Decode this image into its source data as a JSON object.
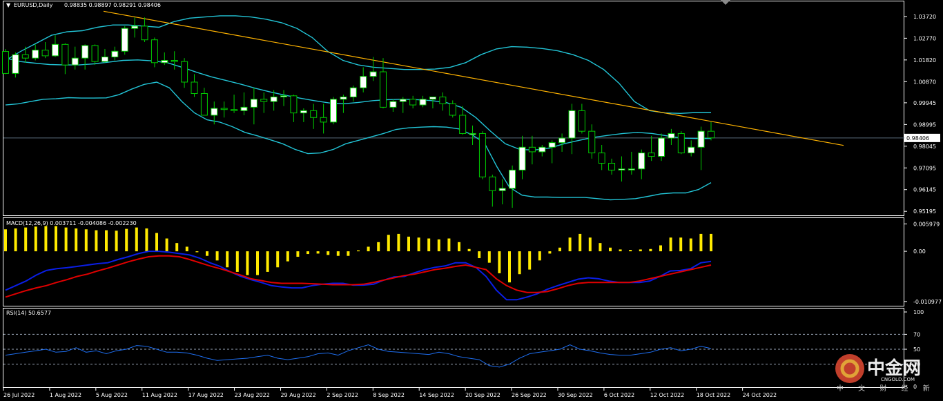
{
  "header": {
    "arrow": "▼",
    "symbol": "EURUSD,Daily",
    "ohlc": "0.98835 0.98897 0.98291 0.98406"
  },
  "colors": {
    "background": "#000000",
    "grid_frame": "#ffffff",
    "bull_candle": "#ffffff",
    "bear_candle": "#000000",
    "wick": "#00cc00",
    "bollinger": "#22c4d6",
    "trendline": "#ffb300",
    "macd_hist": "#ffea00",
    "macd_line": "#0a1ee6",
    "signal_line": "#e00000",
    "rsi_line": "#1e6ef0",
    "level_line": "#9aa6b8"
  },
  "chart_data": [
    {
      "type": "candlestick",
      "title": "EURUSD,Daily",
      "ohlc_label": "0.98835 0.98897 0.98291 0.98406",
      "current_price_label": "0.98406",
      "ylim": [
        0.9514,
        1.0402
      ],
      "y_ticks": [
        "1.03720",
        "1.02770",
        "1.01820",
        "1.00870",
        "0.99945",
        "0.98995",
        "0.98045",
        "0.97095",
        "0.96145",
        "0.95195"
      ],
      "x_tick_labels": [
        "26 Jul 2022",
        "1 Aug 2022",
        "5 Aug 2022",
        "11 Aug 2022",
        "17 Aug 2022",
        "23 Aug 2022",
        "29 Aug 2022",
        "2 Sep 2022",
        "8 Sep 2022",
        "14 Sep 2022",
        "20 Sep 2022",
        "26 Sep 2022",
        "30 Sep 2022",
        "6 Oct 2022",
        "12 Oct 2022",
        "18 Oct 2022",
        "24 Oct 2022"
      ],
      "trendline": {
        "start_value": 1.0395,
        "end_value": 0.9808
      },
      "bollinger": {
        "upper": [
          1.018,
          1.022,
          1.0255,
          1.029,
          1.0305,
          1.031,
          1.0325,
          1.0335,
          1.0335,
          1.033,
          1.0325,
          1.035,
          1.0365,
          1.037,
          1.0375,
          1.0375,
          1.037,
          1.036,
          1.0345,
          1.032,
          1.028,
          1.022,
          1.018,
          1.016,
          1.015,
          1.0145,
          1.014,
          1.014,
          1.0142,
          1.015,
          1.017,
          1.0205,
          1.023,
          1.024,
          1.0238,
          1.0232,
          1.0222,
          1.0205,
          1.018,
          1.014,
          1.008,
          1.0,
          0.996,
          0.995,
          0.9948,
          0.9952,
          0.9952
        ],
        "middle": [
          1.019,
          1.0175,
          1.0168,
          1.0162,
          1.016,
          1.016,
          1.0165,
          1.0172,
          1.018,
          1.0182,
          1.0178,
          1.017,
          1.015,
          1.0128,
          1.0108,
          1.0092,
          1.0076,
          1.0058,
          1.0042,
          1.0028,
          1.0015,
          1.0004,
          0.9994,
          0.999,
          0.9996,
          1.0004,
          1.0008,
          1.001,
          1.0008,
          1.0004,
          0.9995,
          0.9975,
          0.993,
          0.987,
          0.9815,
          0.979,
          0.9788,
          0.9796,
          0.9815,
          0.983,
          0.9843,
          0.9852,
          0.986,
          0.9865,
          0.986,
          0.985,
          0.984,
          0.9838,
          0.9838
        ],
        "lower": [
          0.9985,
          0.999,
          1.0,
          1.001,
          1.0012,
          1.0017,
          1.0015,
          1.0015,
          1.0016,
          1.003,
          1.0054,
          1.0075,
          1.0085,
          1.006,
          1.0,
          0.995,
          0.992,
          0.991,
          0.989,
          0.9865,
          0.985,
          0.9833,
          0.9815,
          0.979,
          0.9772,
          0.9775,
          0.979,
          0.9815,
          0.983,
          0.9845,
          0.986,
          0.9878,
          0.9885,
          0.9888,
          0.989,
          0.9888,
          0.988,
          0.9855,
          0.982,
          0.9715,
          0.9625,
          0.959,
          0.9582,
          0.9582,
          0.958,
          0.958,
          0.958,
          0.9575,
          0.957,
          0.9572,
          0.9575,
          0.9585,
          0.9596,
          0.96,
          0.96,
          0.9615,
          0.9645
        ]
      },
      "candles": [
        [
          1.0219,
          1.023,
          1.012,
          1.0123
        ],
        [
          1.0123,
          1.0215,
          1.0105,
          1.0205
        ],
        [
          1.0205,
          1.024,
          1.017,
          1.019
        ],
        [
          1.019,
          1.025,
          1.018,
          1.0225
        ],
        [
          1.0225,
          1.026,
          1.019,
          1.02
        ],
        [
          1.02,
          1.029,
          1.0195,
          1.025
        ],
        [
          1.025,
          1.0255,
          1.012,
          1.016
        ],
        [
          1.016,
          1.024,
          1.014,
          1.019
        ],
        [
          1.019,
          1.025,
          1.014,
          1.0245
        ],
        [
          1.0245,
          1.025,
          1.016,
          1.0175
        ],
        [
          1.0175,
          1.023,
          1.017,
          1.0195
        ],
        [
          1.0195,
          1.024,
          1.018,
          1.022
        ],
        [
          1.022,
          1.033,
          1.0205,
          1.032
        ],
        [
          1.032,
          1.0368,
          1.028,
          1.033
        ],
        [
          1.033,
          1.0368,
          1.026,
          1.027
        ],
        [
          1.027,
          1.028,
          1.015,
          1.017
        ],
        [
          1.017,
          1.0215,
          1.016,
          1.018
        ],
        [
          1.018,
          1.022,
          1.014,
          1.0175
        ],
        [
          1.0175,
          1.019,
          1.006,
          1.0085
        ],
        [
          1.0085,
          1.012,
          1.002,
          1.0035
        ],
        [
          1.0035,
          1.006,
          0.994,
          0.994
        ],
        [
          0.994,
          1.0,
          0.99,
          0.997
        ],
        [
          0.997,
          1.0,
          0.993,
          0.9965
        ],
        [
          0.9965,
          1.003,
          0.995,
          0.996
        ],
        [
          0.996,
          1.004,
          0.994,
          0.9975
        ],
        [
          0.9975,
          1.006,
          0.99,
          1.001
        ],
        [
          1.001,
          1.004,
          0.995,
          1.0
        ],
        [
          1.0,
          1.005,
          0.996,
          1.002
        ],
        [
          1.002,
          1.005,
          0.998,
          1.0025
        ],
        [
          1.0025,
          1.003,
          0.991,
          0.995
        ],
        [
          0.995,
          0.997,
          0.991,
          0.996
        ],
        [
          0.996,
          0.999,
          0.988,
          0.993
        ],
        [
          0.993,
          0.999,
          0.986,
          0.991
        ],
        [
          0.991,
          1.002,
          0.99,
          1.001
        ],
        [
          1.001,
          1.003,
          0.995,
          1.002
        ],
        [
          1.002,
          1.007,
          1.0,
          1.006
        ],
        [
          1.006,
          1.015,
          1.004,
          1.011
        ],
        [
          1.011,
          1.0195,
          1.009,
          1.013
        ],
        [
          1.013,
          1.019,
          0.997,
          0.9975
        ],
        [
          0.9975,
          1.001,
          0.9955,
          1.0
        ],
        [
          1.0,
          1.002,
          0.995,
          1.001
        ],
        [
          1.001,
          1.0025,
          0.997,
          0.9985
        ],
        [
          0.9985,
          1.0025,
          0.9975,
          1.001
        ],
        [
          1.001,
          1.002,
          0.997,
          1.002
        ],
        [
          1.002,
          1.004,
          0.996,
          0.999
        ],
        [
          0.999,
          1.0005,
          0.993,
          0.994
        ],
        [
          0.994,
          0.998,
          0.9855,
          0.986
        ],
        [
          0.986,
          0.9895,
          0.981,
          0.986
        ],
        [
          0.986,
          0.987,
          0.966,
          0.967
        ],
        [
          0.967,
          0.968,
          0.954,
          0.961
        ],
        [
          0.961,
          0.966,
          0.955,
          0.962
        ],
        [
          0.962,
          0.972,
          0.9535,
          0.97
        ],
        [
          0.97,
          0.985,
          0.966,
          0.98
        ],
        [
          0.98,
          0.985,
          0.9725,
          0.978
        ],
        [
          0.978,
          0.981,
          0.976,
          0.98
        ],
        [
          0.98,
          0.983,
          0.973,
          0.982
        ],
        [
          0.982,
          0.986,
          0.978,
          0.984
        ],
        [
          0.984,
          0.999,
          0.977,
          0.996
        ],
        [
          0.996,
          0.999,
          0.986,
          0.987
        ],
        [
          0.987,
          0.99,
          0.975,
          0.9775
        ],
        [
          0.9775,
          0.981,
          0.97,
          0.973
        ],
        [
          0.973,
          0.975,
          0.968,
          0.97
        ],
        [
          0.97,
          0.976,
          0.965,
          0.9705
        ],
        [
          0.9705,
          0.978,
          0.968,
          0.9705
        ],
        [
          0.9705,
          0.979,
          0.966,
          0.9775
        ],
        [
          0.9775,
          0.985,
          0.974,
          0.976
        ],
        [
          0.976,
          0.986,
          0.974,
          0.984
        ],
        [
          0.984,
          0.988,
          0.981,
          0.986
        ],
        [
          0.986,
          0.987,
          0.977,
          0.9775
        ],
        [
          0.9775,
          0.983,
          0.976,
          0.98
        ],
        [
          0.98,
          0.989,
          0.97,
          0.987
        ],
        [
          0.987,
          0.991,
          0.983,
          0.9841
        ]
      ]
    },
    {
      "type": "bar+line",
      "title": "MACD(12,26,9) 0.003711 -0.004086 -0.002230",
      "ylim": [
        -0.011,
        0.0065
      ],
      "y_ticks": [
        "0.005979",
        "0.00",
        "-0.010977"
      ],
      "histogram": [
        0.0048,
        0.005,
        0.0052,
        0.0054,
        0.0055,
        0.0055,
        0.0052,
        0.005,
        0.0048,
        0.0046,
        0.0046,
        0.0045,
        0.0049,
        0.0052,
        0.005,
        0.004,
        0.0028,
        0.0018,
        0.001,
        -0.0002,
        -0.001,
        -0.002,
        -0.0035,
        -0.0045,
        -0.0052,
        -0.0052,
        -0.0045,
        -0.0035,
        -0.0022,
        -0.0012,
        -0.0006,
        -0.0005,
        -0.0008,
        -0.001,
        -0.001,
        0.0002,
        0.001,
        0.002,
        0.0036,
        0.0038,
        0.0032,
        0.003,
        0.0028,
        0.0026,
        0.0028,
        0.002,
        0.0005,
        -0.0015,
        -0.0025,
        -0.0048,
        -0.0068,
        -0.005,
        -0.004,
        -0.002,
        -0.0005,
        0.0008,
        0.003,
        0.0038,
        0.003,
        0.0018,
        0.0008,
        0.0004,
        0.0003,
        0.0004,
        0.0005,
        0.0013,
        0.003,
        0.003,
        0.0028,
        0.0038,
        0.0038
      ],
      "macd_line": [
        -0.0085,
        -0.0075,
        -0.0065,
        -0.0052,
        -0.0042,
        -0.0038,
        -0.0036,
        -0.0033,
        -0.003,
        -0.0027,
        -0.0025,
        -0.0018,
        -0.0012,
        -0.0005,
        0.0,
        0.0,
        -0.0002,
        -0.0005,
        -0.0008,
        -0.0015,
        -0.0025,
        -0.0033,
        -0.0045,
        -0.0055,
        -0.0062,
        -0.0068,
        -0.0075,
        -0.0078,
        -0.008,
        -0.008,
        -0.0075,
        -0.0072,
        -0.007,
        -0.007,
        -0.0074,
        -0.0074,
        -0.0072,
        -0.0063,
        -0.0056,
        -0.0055,
        -0.0047,
        -0.004,
        -0.0035,
        -0.0032,
        -0.0025,
        -0.0025,
        -0.0035,
        -0.0055,
        -0.0085,
        -0.0106,
        -0.0106,
        -0.01,
        -0.0093,
        -0.0083,
        -0.0075,
        -0.0068,
        -0.0061,
        -0.0058,
        -0.006,
        -0.0065,
        -0.0068,
        -0.0068,
        -0.0068,
        -0.0065,
        -0.0055,
        -0.0043,
        -0.0042,
        -0.0038,
        -0.0025,
        -0.0022
      ],
      "signal_line": [
        -0.01,
        -0.0093,
        -0.0086,
        -0.008,
        -0.0075,
        -0.0068,
        -0.0062,
        -0.0055,
        -0.005,
        -0.0043,
        -0.0037,
        -0.003,
        -0.0023,
        -0.0017,
        -0.0012,
        -0.001,
        -0.001,
        -0.0012,
        -0.0018,
        -0.0025,
        -0.0032,
        -0.0038,
        -0.0045,
        -0.0052,
        -0.006,
        -0.0064,
        -0.0068,
        -0.007,
        -0.007,
        -0.007,
        -0.0071,
        -0.0072,
        -0.0073,
        -0.0073,
        -0.0073,
        -0.0072,
        -0.0068,
        -0.0063,
        -0.0058,
        -0.0053,
        -0.005,
        -0.0045,
        -0.004,
        -0.0037,
        -0.0033,
        -0.003,
        -0.0035,
        -0.004,
        -0.006,
        -0.0075,
        -0.0085,
        -0.009,
        -0.009,
        -0.0088,
        -0.0082,
        -0.0075,
        -0.007,
        -0.0068,
        -0.0068,
        -0.0068,
        -0.0068,
        -0.0068,
        -0.0065,
        -0.006,
        -0.0055,
        -0.005,
        -0.0045,
        -0.004,
        -0.0035,
        -0.003
      ]
    },
    {
      "type": "line",
      "title": "RSI(14) 50.6577",
      "ylim": [
        0,
        100
      ],
      "y_ticks": [
        "100",
        "70",
        "50",
        "30",
        "0"
      ],
      "levels": [
        70,
        50,
        30
      ],
      "values": [
        42,
        44,
        46,
        48,
        50,
        46,
        47,
        52,
        46,
        48,
        44,
        48,
        50,
        55,
        54,
        50,
        46,
        46,
        45,
        42,
        38,
        35,
        36,
        37,
        38,
        40,
        42,
        38,
        36,
        38,
        40,
        44,
        45,
        42,
        48,
        52,
        56,
        50,
        47,
        46,
        45,
        44,
        43,
        46,
        44,
        40,
        38,
        36,
        28,
        26,
        30,
        38,
        44,
        46,
        48,
        50,
        56,
        50,
        48,
        45,
        43,
        42,
        42,
        44,
        46,
        50,
        52,
        48,
        50,
        54,
        51
      ]
    }
  ],
  "watermark": {
    "cn_name": "中金网",
    "domain": "CNGOLD.COM",
    "subtitle": "中 文 财 经 新 媒 体"
  }
}
